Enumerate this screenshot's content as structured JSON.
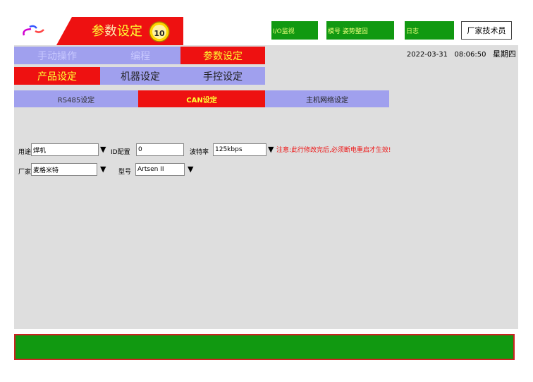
{
  "header": {
    "title_left": "参",
    "title_mid": "数",
    "title_right": "设定",
    "gauge_value": "10",
    "io_monitor": "I/O监视",
    "mold_label": "模号 姿势整固",
    "log_label": "日志",
    "user_button": "厂家技术员"
  },
  "status": {
    "date": "2022-03-31",
    "time": "08:06:50",
    "weekday": "星期四"
  },
  "nav": {
    "row1": [
      "手动操作",
      "编程",
      "参数设定"
    ],
    "row2": [
      "产品设定",
      "机器设定",
      "手控设定"
    ]
  },
  "subtabs": [
    "RS485设定",
    "CAN设定",
    "主机网络设定"
  ],
  "form": {
    "usage_label": "用途",
    "usage_value": "焊机",
    "id_label": "ID配置",
    "id_value": "0",
    "baud_label": "波特率",
    "baud_value": "125kbps",
    "warning": "注意:此行修改完后,必须断电重启才生效!",
    "vendor_label": "厂家",
    "vendor_value": "麦格米特",
    "model_label": "型号",
    "model_value": "Artsen II"
  },
  "colors": {
    "accent_red": "#ee1111",
    "tab_lavender": "#a0a0ee",
    "bar_green": "#119911",
    "text_yellow": "#ffff33"
  },
  "icons": [
    "link-icon",
    "gauge-icon",
    "dropdown-arrow-icon"
  ]
}
